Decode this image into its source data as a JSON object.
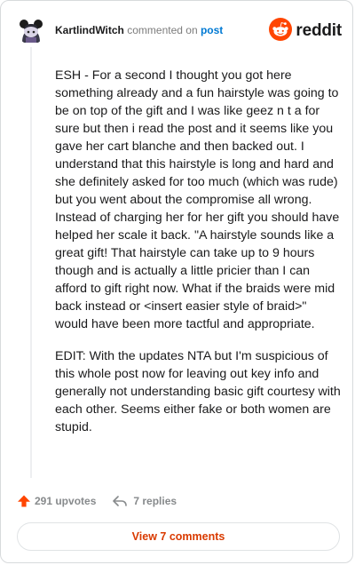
{
  "header": {
    "username": "KartlindWitch",
    "commented_text": "commented on",
    "post_link": "post",
    "brand": "reddit"
  },
  "comment": {
    "paragraphs": [
      "ESH - For a second I thought you got here something already and a fun hairstyle was going to be on top of the gift and I was like geez n t a for sure but then i read the post and it seems like you gave her cart blanche and then backed out. I understand that this hairstyle is long and hard and she definitely asked for too much (which was rude) but you went about the compromise all wrong. Instead of charging her for her gift you should have helped her scale it back. \"A hairstyle sounds like a great gift! That hairstyle can take up to 9 hours though and is actually a little pricier than I can afford to gift right now. What if the braids were mid back instead or <insert easier style of braid>\" would have been more tactful and appropriate.",
      "EDIT: With the updates NTA but I'm suspicious of this whole post now for leaving out key info and generally not understanding basic gift courtesy with each other. Seems either fake or both women are stupid."
    ]
  },
  "actions": {
    "upvotes": "291 upvotes",
    "replies": "7 replies"
  },
  "view_button": "View 7 comments",
  "colors": {
    "reddit_orange": "#ff4500",
    "link_blue": "#0079d3",
    "view_button_text": "#d93a00",
    "muted": "#878a8c"
  },
  "icons": [
    "user-avatar",
    "reddit-logo-icon",
    "upvote-arrow-icon",
    "reply-arrow-icon"
  ]
}
